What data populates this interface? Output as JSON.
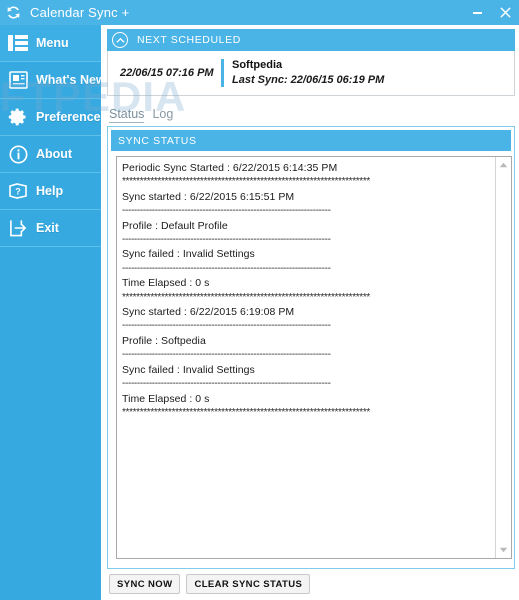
{
  "window": {
    "title": "Calendar Sync +",
    "app_icon": "sync-refresh-icon",
    "minimize_label": "–",
    "close_label": "×",
    "accent_color": "#4bb4e6",
    "sidebar_color": "#36a9e1"
  },
  "watermark": {
    "text": "SOFTPEDIA"
  },
  "sidebar": {
    "items": [
      {
        "label": "Menu",
        "icon": "menu-grid-icon",
        "active": true
      },
      {
        "label": "What's New",
        "icon": "newspaper-icon",
        "active": false
      },
      {
        "label": "Preferences",
        "icon": "gear-icon",
        "active": false
      },
      {
        "label": "About",
        "icon": "info-circle-icon",
        "active": false
      },
      {
        "label": "Help",
        "icon": "help-book-icon",
        "active": false
      },
      {
        "label": "Exit",
        "icon": "exit-arrow-icon",
        "active": false
      }
    ]
  },
  "next_scheduled": {
    "header": "NEXT SCHEDULED",
    "toggle_icon": "chevron-up-circle-icon",
    "time": "22/06/15 07:16 PM",
    "profile": "Softpedia",
    "last_sync": "Last Sync: 22/06/15 06:19 PM"
  },
  "tabs": [
    {
      "label": "Status",
      "active": true
    },
    {
      "label": "Log",
      "active": false
    }
  ],
  "sync_status": {
    "header": "SYNC STATUS",
    "lines": [
      {
        "text": "Periodic Sync Started : 6/22/2015 6:14:35 PM",
        "type": "entry"
      },
      {
        "text": "**********************************************************************",
        "type": "sep"
      },
      {
        "text": "Sync started : 6/22/2015 6:15:51 PM",
        "type": "entry"
      },
      {
        "text": "----------------------------------------------------------------------",
        "type": "sep"
      },
      {
        "text": "Profile : Default Profile",
        "type": "entry"
      },
      {
        "text": "----------------------------------------------------------------------",
        "type": "sep"
      },
      {
        "text": "Sync failed : Invalid Settings",
        "type": "entry"
      },
      {
        "text": "----------------------------------------------------------------------",
        "type": "sep"
      },
      {
        "text": "Time Elapsed : 0 s",
        "type": "entry"
      },
      {
        "text": "**********************************************************************",
        "type": "sep"
      },
      {
        "text": "Sync started : 6/22/2015 6:19:08 PM",
        "type": "entry"
      },
      {
        "text": "----------------------------------------------------------------------",
        "type": "sep"
      },
      {
        "text": "Profile : Softpedia",
        "type": "entry"
      },
      {
        "text": "----------------------------------------------------------------------",
        "type": "sep"
      },
      {
        "text": "Sync failed : Invalid Settings",
        "type": "entry"
      },
      {
        "text": "----------------------------------------------------------------------",
        "type": "sep"
      },
      {
        "text": "Time Elapsed : 0 s",
        "type": "entry"
      },
      {
        "text": "**********************************************************************",
        "type": "sep"
      }
    ],
    "scrollbar": {
      "up_icon": "triangle-up-icon",
      "down_icon": "triangle-down-icon"
    }
  },
  "buttons": {
    "sync_now": "SYNC NOW",
    "clear_sync_status": "CLEAR SYNC STATUS"
  }
}
